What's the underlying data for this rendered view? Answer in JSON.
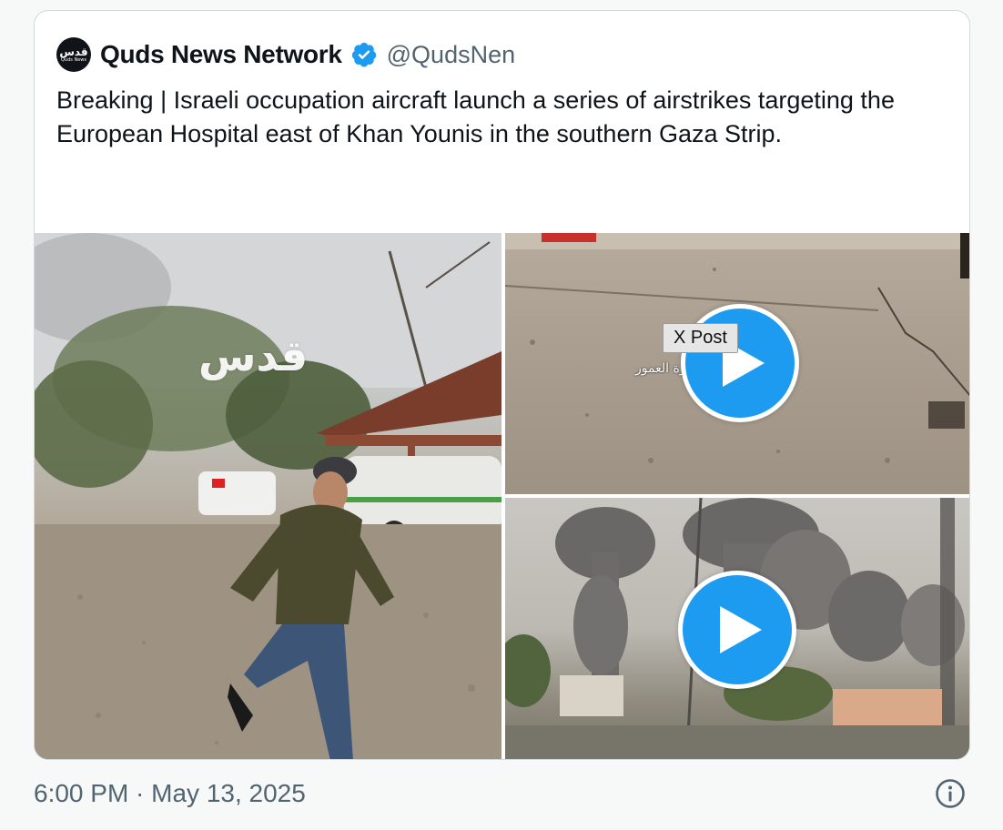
{
  "tweet": {
    "author_name": "Quds News Network",
    "handle": "@QudsNen",
    "avatar_logo": "قدس",
    "avatar_sub": "Quds News",
    "text": "Breaking | Israeli occupation aircraft launch a series of airstrikes targeting the European Hospital east of Khan Younis in the southern Gaza Strip.",
    "timestamp": "6:00 PM · May 13, 2025"
  },
  "media": {
    "left_image": {
      "watermark": "قدس",
      "description_icon": "photo"
    },
    "top_right_video": {
      "tooltip": "X Post",
      "overlay_text": "#غزة العمور"
    },
    "bottom_right_video": {}
  },
  "colors": {
    "accent": "#1d9bf0",
    "text": "#0f1419",
    "secondary_text": "#536471",
    "border": "#cfd9de"
  },
  "icons": {
    "verified": "verified-badge-icon",
    "play": "play-icon",
    "info": "info-icon"
  }
}
